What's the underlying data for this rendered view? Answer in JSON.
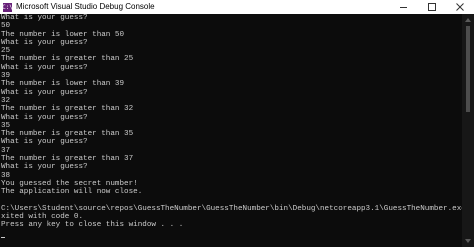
{
  "window": {
    "title": "Microsoft Visual Studio Debug Console",
    "icon": "vs-console-icon",
    "icon_glyph": "C:\\",
    "background": "#0c0c0c",
    "text_color": "#cccccc"
  },
  "console": {
    "lines": [
      "What is your guess?",
      "50",
      "The number is lower than 50",
      "What is your guess?",
      "25",
      "The number is greater than 25",
      "What is your guess?",
      "39",
      "The number is lower than 39",
      "What is your guess?",
      "32",
      "The number is greater than 32",
      "What is your guess?",
      "35",
      "The number is greater than 35",
      "What is your guess?",
      "37",
      "The number is greater than 37",
      "What is your guess?",
      "38",
      "You guessed the secret number!",
      "The application will now close.",
      "",
      "C:\\Users\\Student\\source\\repos\\GuessTheNumber\\GuessTheNumber\\bin\\Debug\\netcoreapp3.1\\GuessTheNumber.exe (process 21328) e",
      "xited with code 0.",
      "Press any key to close this window . . ."
    ]
  }
}
